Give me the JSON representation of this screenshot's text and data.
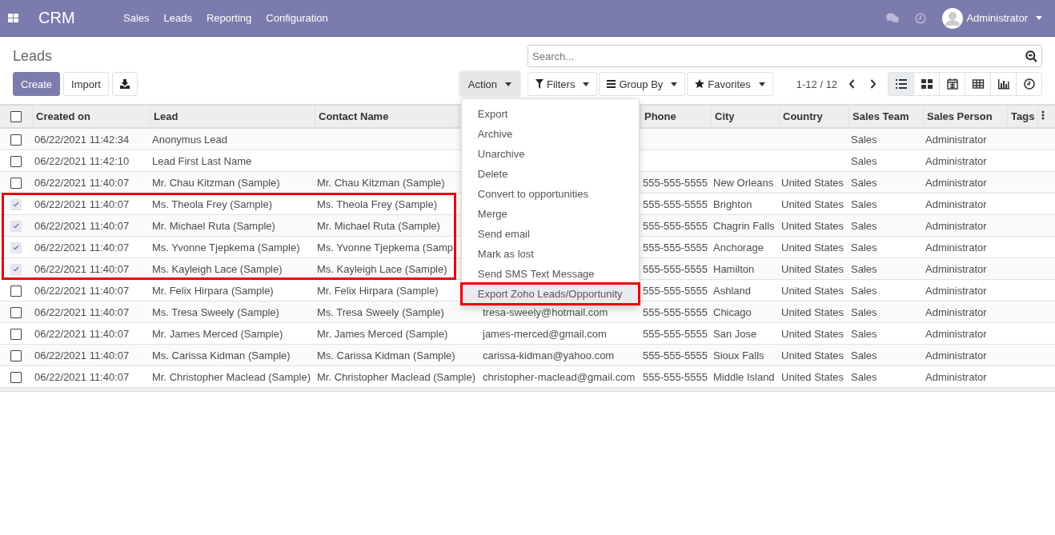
{
  "navbar": {
    "app_name": "CRM",
    "menu": [
      "Sales",
      "Leads",
      "Reporting",
      "Configuration"
    ],
    "user": "Administrator"
  },
  "control_panel": {
    "title": "Leads",
    "buttons": {
      "create": "Create",
      "import": "Import"
    },
    "action": {
      "label": "Action",
      "expanded": true,
      "items": [
        {
          "label": "Export",
          "annotated": false,
          "selected": false
        },
        {
          "label": "Archive",
          "annotated": false,
          "selected": false
        },
        {
          "label": "Unarchive",
          "annotated": false,
          "selected": false
        },
        {
          "label": "Delete",
          "annotated": false,
          "selected": false
        },
        {
          "label": "Convert to opportunities",
          "annotated": false,
          "selected": false
        },
        {
          "label": "Merge",
          "annotated": false,
          "selected": false
        },
        {
          "label": "Send email",
          "annotated": false,
          "selected": false
        },
        {
          "label": "Mark as lost",
          "annotated": false,
          "selected": false
        },
        {
          "label": "Send SMS Text Message",
          "annotated": false,
          "selected": false
        },
        {
          "label": "Export Zoho Leads/Opportunity",
          "annotated": true,
          "selected": true
        }
      ]
    },
    "search": {
      "placeholder": "Search..."
    },
    "filters": [
      {
        "kind": "filter",
        "label": "Filters"
      },
      {
        "kind": "group",
        "label": "Group By"
      },
      {
        "kind": "favorites",
        "label": "Favorites"
      }
    ],
    "pager": "1-12 / 12",
    "views": [
      {
        "kind": "list",
        "selected": true
      },
      {
        "kind": "kanban",
        "selected": false
      },
      {
        "kind": "calendar",
        "selected": false
      },
      {
        "kind": "pivot",
        "selected": false
      },
      {
        "kind": "graph",
        "selected": false
      },
      {
        "kind": "activity",
        "selected": false
      }
    ]
  },
  "table": {
    "all_selected": false,
    "columns": [
      "Created on",
      "Lead",
      "Contact Name",
      "Phone",
      "City",
      "Country",
      "Sales Team",
      "Sales Person",
      "Tags"
    ],
    "rows": [
      {
        "selected": false,
        "annotated": false,
        "created_on": "06/22/2021 11:42:34",
        "lead": "Anonymus Lead",
        "team": "Sales",
        "person": "Administrator"
      },
      {
        "selected": false,
        "annotated": false,
        "created_on": "06/22/2021 11:42:10",
        "lead": "Lead First Last Name",
        "team": "Sales",
        "person": "Administrator"
      },
      {
        "selected": false,
        "annotated": false,
        "created_on": "06/22/2021 11:40:07",
        "lead": "Mr. Chau Kitzman (Sample)",
        "contact": "Mr. Chau Kitzman (Sample)",
        "phone": "555-555-5555",
        "city": "New Orleans",
        "country": "United States",
        "team": "Sales",
        "person": "Administrator"
      },
      {
        "selected": true,
        "annotated": true,
        "created_on": "06/22/2021 11:40:07",
        "lead": "Ms. Theola Frey (Sample)",
        "contact": "Ms. Theola Frey (Sample)",
        "phone": "555-555-5555",
        "city": "Brighton",
        "country": "United States",
        "team": "Sales",
        "person": "Administrator"
      },
      {
        "selected": true,
        "annotated": true,
        "created_on": "06/22/2021 11:40:07",
        "lead": "Mr. Michael Ruta (Sample)",
        "contact": "Mr. Michael Ruta (Sample)",
        "phone": "555-555-5555",
        "city": "Chagrin Falls",
        "country": "United States",
        "team": "Sales",
        "person": "Administrator"
      },
      {
        "selected": true,
        "annotated": true,
        "created_on": "06/22/2021 11:40:07",
        "lead": "Ms. Yvonne Tjepkema (Sample)",
        "contact": "Ms. Yvonne Tjepkema (Samp",
        "phone": "555-555-5555",
        "city": "Anchorage",
        "country": "United States",
        "team": "Sales",
        "person": "Administrator"
      },
      {
        "selected": true,
        "annotated": true,
        "created_on": "06/22/2021 11:40:07",
        "lead": "Ms. Kayleigh Lace (Sample)",
        "contact": "Ms. Kayleigh Lace (Sample)",
        "phone": "555-555-5555",
        "city": "Hamilton",
        "country": "United States",
        "team": "Sales",
        "person": "Administrator"
      },
      {
        "selected": false,
        "annotated": false,
        "created_on": "06/22/2021 11:40:07",
        "lead": "Mr. Felix Hirpara (Sample)",
        "contact": "Mr. Felix Hirpara (Sample)",
        "phone": "555-555-5555",
        "city": "Ashland",
        "country": "United States",
        "team": "Sales",
        "person": "Administrator"
      },
      {
        "selected": false,
        "annotated": false,
        "created_on": "06/22/2021 11:40:07",
        "lead": "Ms. Tresa Sweely (Sample)",
        "contact": "Ms. Tresa Sweely (Sample)",
        "email": "tresa-sweely@hotmail.com",
        "phone": "555-555-5555",
        "city": "Chicago",
        "country": "United States",
        "team": "Sales",
        "person": "Administrator"
      },
      {
        "selected": false,
        "annotated": false,
        "created_on": "06/22/2021 11:40:07",
        "lead": "Mr. James Merced (Sample)",
        "contact": "Mr. James Merced (Sample)",
        "email": "james-merced@gmail.com",
        "phone": "555-555-5555",
        "city": "San Jose",
        "country": "United States",
        "team": "Sales",
        "person": "Administrator"
      },
      {
        "selected": false,
        "annotated": false,
        "created_on": "06/22/2021 11:40:07",
        "lead": "Ms. Carissa Kidman (Sample)",
        "contact": "Ms. Carissa Kidman (Sample)",
        "email": "carissa-kidman@yahoo.com",
        "phone": "555-555-5555",
        "city": "Sioux Falls",
        "country": "United States",
        "team": "Sales",
        "person": "Administrator"
      },
      {
        "selected": false,
        "annotated": false,
        "created_on": "06/22/2021 11:40:07",
        "lead": "Mr. Christopher Maclead (Sample)",
        "contact": "Mr. Christopher Maclead (Sample)",
        "email": "christopher-maclead@gmail.com",
        "phone": "555-555-5555",
        "city": "Middle Island",
        "country": "United States",
        "team": "Sales",
        "person": "Administrator"
      }
    ]
  }
}
